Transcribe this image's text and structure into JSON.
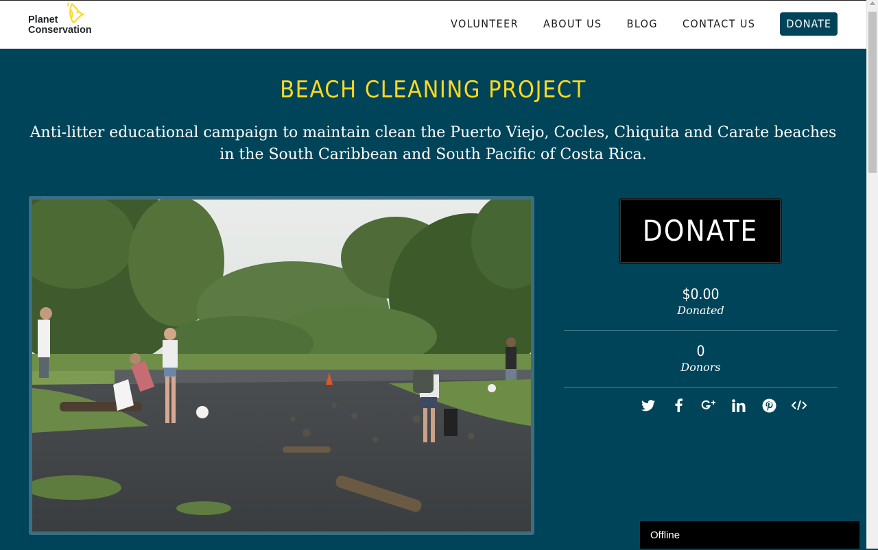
{
  "logo": {
    "line1": "Planet",
    "line2": "Conservation",
    "icon": "fish-icon",
    "accent_color": "#ffd91e"
  },
  "nav": {
    "items": [
      {
        "label": "VOLUNTEER"
      },
      {
        "label": "ABOUT US"
      },
      {
        "label": "BLOG"
      },
      {
        "label": "CONTACT US"
      }
    ],
    "donate_label": "DONATE"
  },
  "hero": {
    "title": "BEACH CLEANING PROJECT",
    "subtitle": "Anti-litter educational campaign to maintain clean the Puerto Viejo, Cocles, Chiquita and Carate beaches in the South Caribbean and South Pacific of Costa Rica."
  },
  "sidebar": {
    "donate_button": "DONATE",
    "donated": {
      "value": "$0.00",
      "label": "Donated"
    },
    "donors": {
      "value": "0",
      "label": "Donors"
    },
    "share_icons": [
      "twitter-icon",
      "facebook-icon",
      "google-plus-icon",
      "linkedin-icon",
      "pinterest-icon",
      "embed-code-icon"
    ]
  },
  "chat": {
    "status": "Offline"
  },
  "colors": {
    "background": "#00445a",
    "title": "#ffd91e",
    "header_bg": "#ffffff",
    "donate_btn": "#000000"
  }
}
